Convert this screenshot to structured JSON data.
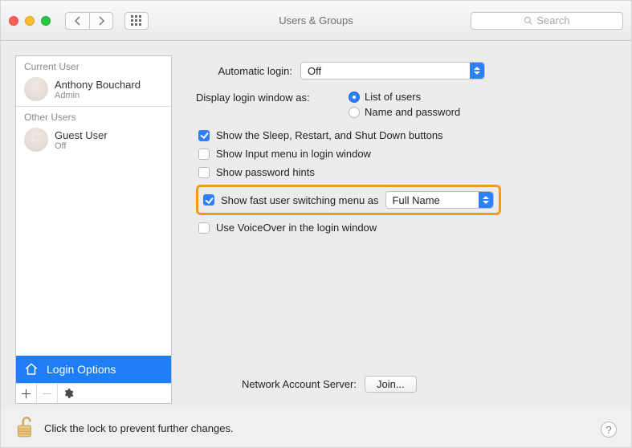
{
  "window_title": "Users & Groups",
  "search": {
    "placeholder": "Search"
  },
  "sidebar": {
    "current_label": "Current User",
    "other_label": "Other Users",
    "current": {
      "name": "Anthony Bouchard",
      "role": "Admin"
    },
    "other": [
      {
        "name": "Guest User",
        "role": "Off"
      }
    ],
    "login_options_label": "Login Options"
  },
  "main": {
    "automatic_login_label": "Automatic login:",
    "automatic_login_value": "Off",
    "display_login_label": "Display login window as:",
    "display_login_options": {
      "list": "List of users",
      "namepw": "Name and password"
    },
    "display_login_selected": "list",
    "checks": {
      "sleep": {
        "label": "Show the Sleep, Restart, and Shut Down buttons",
        "checked": true
      },
      "input_menu": {
        "label": "Show Input menu in login window",
        "checked": false
      },
      "pw_hints": {
        "label": "Show password hints",
        "checked": false
      },
      "fast_switch": {
        "label": "Show fast user switching menu as",
        "checked": true,
        "value": "Full Name"
      },
      "voiceover": {
        "label": "Use VoiceOver in the login window",
        "checked": false
      }
    },
    "network_server_label": "Network Account Server:",
    "join_label": "Join..."
  },
  "footer": {
    "lock_text": "Click the lock to prevent further changes."
  }
}
